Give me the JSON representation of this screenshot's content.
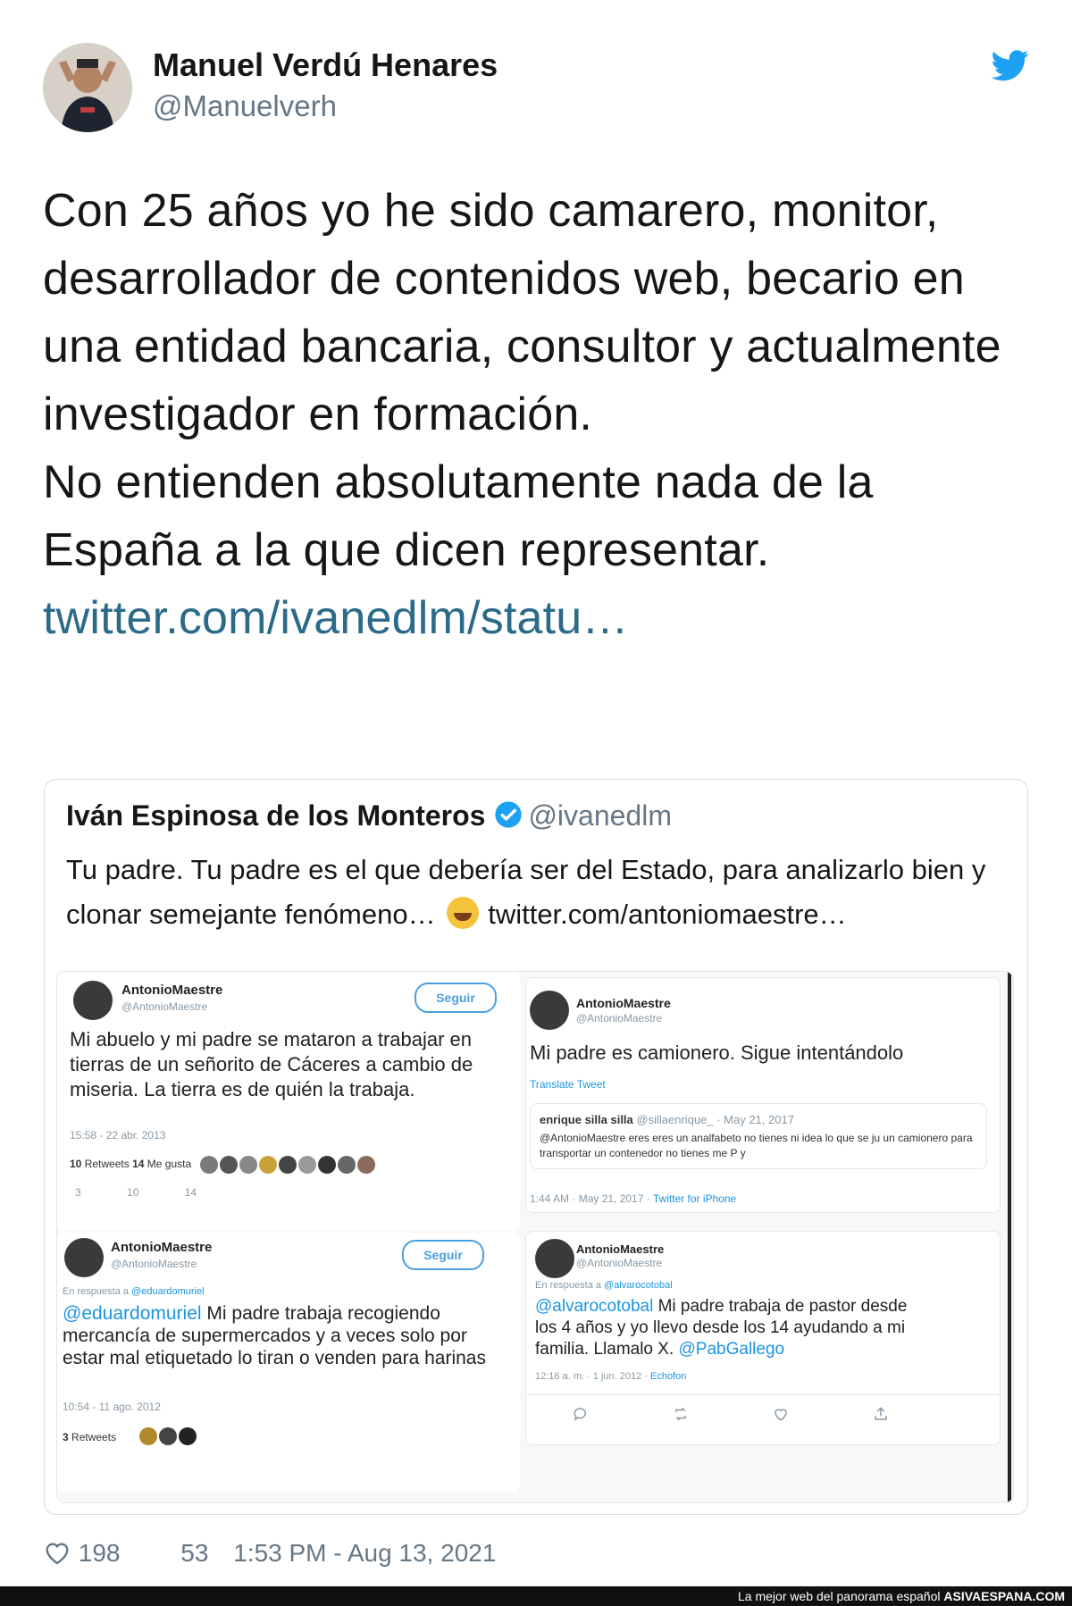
{
  "author": {
    "name": "Manuel Verdú Henares",
    "handle": "@Manuelverh"
  },
  "tweet": {
    "lines": [
      "Con 25 años yo he sido camarero, monitor, desarrollador de contenidos web, becario en una entidad bancaria, consultor y actualmente investigador en formación.",
      "No entienden absolutamente nada de la España a la que dicen representar."
    ],
    "link": "twitter.com/ivanedlm/statu…"
  },
  "quote": {
    "name": "Iván Espinosa de los Monteros",
    "handle": "@ivanedlm",
    "text_before": "Tu padre. Tu padre es el que debería ser del Estado, para analizarlo bien y clonar semejante fenómeno…",
    "link": "twitter.com/antoniomaestre…"
  },
  "cards": {
    "c1": {
      "name": "AntonioMaestre",
      "handle": "@AntonioMaestre",
      "follow": "Seguir",
      "text": "Mi abuelo y mi padre se mataron a trabajar en tierras de un señorito de Cáceres a cambio de miseria. La tierra es de quién la trabaja.",
      "time": "15:58 - 22 abr. 2013",
      "rt": "10",
      "rt_label": "Retweets",
      "likes": "14",
      "likes_label": "Me gusta",
      "a1": "3",
      "a2": "10",
      "a3": "14"
    },
    "c2": {
      "name": "AntonioMaestre",
      "handle": "@AntonioMaestre",
      "text": "Mi padre es camionero. Sigue intentándolo",
      "translate": "Translate Tweet",
      "reply_name": "enrique silla silla",
      "reply_meta": "@sillaenrique_ · May 21, 2017",
      "reply_text": "@AntonioMaestre eres eres un analfabeto no tienes ni idea lo que se ju un camionero para transportar un contenedor no tienes me P y",
      "time": "1:44 AM · May 21, 2017 · ",
      "source": "Twitter for iPhone"
    },
    "c3": {
      "name": "AntonioMaestre",
      "handle": "@AntonioMaestre",
      "follow": "Seguir",
      "reply_to": "En respuesta a ",
      "reply_user": "@eduardomuriel",
      "mention": "@eduardomuriel",
      "text": " Mi padre trabaja recogiendo mercancía de supermercados y a veces solo por estar mal etiquetado lo tiran o venden para harinas",
      "time": "10:54 - 11 ago. 2012",
      "rt": "3",
      "rt_label": "Retweets"
    },
    "c4": {
      "name": "AntonioMaestre",
      "handle": "@AntonioMaestre",
      "reply_to": "En respuesta a ",
      "reply_user": "@alvarocotobal",
      "mention": "@alvarocotobal",
      "text": " Mi padre trabaja de pastor desde los 4 años y yo llevo desde los 14 ayudando a mi familia. Llamalo X. ",
      "mention2": "@PabGallego",
      "time": "12:16 a. m. · 1 jun. 2012 · ",
      "source": "Echofon"
    }
  },
  "footer": {
    "likes": "198",
    "count": "53",
    "timestamp": "1:53 PM - Aug 13, 2021"
  },
  "watermark": {
    "text": "La mejor web del panorama español ",
    "brand": "ASIVAESPANA.COM"
  },
  "colors": {
    "link": "#1b95e0",
    "twitter_blue": "#1da1f2",
    "muted": "#657786"
  },
  "icons": [
    "twitter-bird-icon",
    "verified-badge-icon",
    "heart-icon"
  ]
}
